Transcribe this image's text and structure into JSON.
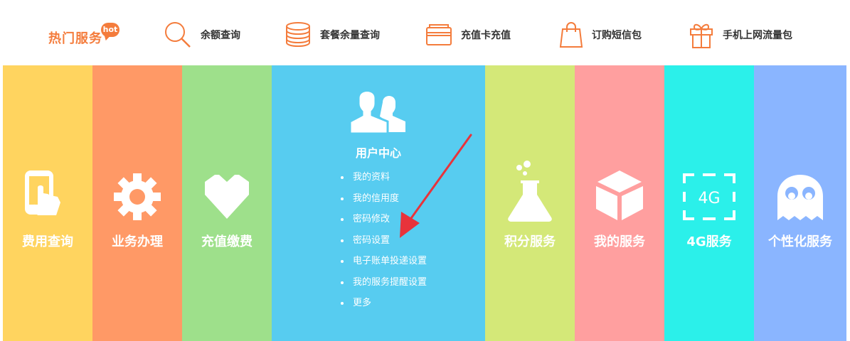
{
  "hot_services": {
    "title": "热门服务",
    "badge": "hot",
    "items": [
      {
        "label": "余额查询",
        "icon": "magnifier-icon"
      },
      {
        "label": "套餐余量查询",
        "icon": "coin-stack-icon"
      },
      {
        "label": "充值卡充值",
        "icon": "card-icon"
      },
      {
        "label": "订购短信包",
        "icon": "shopping-bag-icon"
      },
      {
        "label": "手机上网流量包",
        "icon": "gift-icon"
      }
    ],
    "accent": "#f47c3c"
  },
  "columns": [
    {
      "label": "费用查询",
      "color": "#ffd45f",
      "icon": "phone-tap-icon"
    },
    {
      "label": "业务办理",
      "color": "#ff9966",
      "icon": "gear-icon"
    },
    {
      "label": "充值缴费",
      "color": "#9ee08b",
      "icon": "heart-icon"
    },
    {
      "label": "积分服务",
      "color": "#d4e878",
      "icon": "flask-icon"
    },
    {
      "label": "我的服务",
      "color": "#ff9f9f",
      "icon": "box-icon"
    },
    {
      "label": "4G服务",
      "color": "#2bf0ea",
      "icon": "4g-icon",
      "icon_text": "4G"
    },
    {
      "label": "个性化服务",
      "color": "#8ab5ff",
      "icon": "ghost-icon"
    }
  ],
  "user_center": {
    "title": "用户中心",
    "color": "#57ccf0",
    "icon": "users-icon",
    "items": [
      "我的资料",
      "我的信用度",
      "密码修改",
      "密码设置",
      "电子账单投递设置",
      "我的服务提醒设置",
      "更多"
    ]
  },
  "annotation": {
    "color": "#e8333b"
  }
}
